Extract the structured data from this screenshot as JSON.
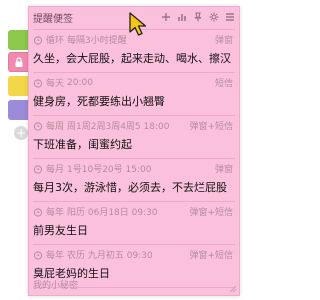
{
  "window": {
    "title": "提醒便签"
  },
  "toolbar": {
    "icons": [
      "add-icon",
      "bar-chart-icon",
      "pin-icon",
      "gear-icon",
      "menu-icon"
    ]
  },
  "reminders": [
    {
      "repeat": "循环",
      "when": "每隔3小时提醒",
      "type": "弹窗",
      "text": "久坐，会大屁股，起来走动、喝水、擦汉"
    },
    {
      "repeat": "每天",
      "when": "20:00",
      "type": "短信",
      "text": "健身房，死都要练出小翘臀"
    },
    {
      "repeat": "每周",
      "when": "周1周2周3周4周5  18:00",
      "type": "弹窗+短信",
      "text": "下班准备，闺蜜约起"
    },
    {
      "repeat": "每月",
      "when": "1号10号20号  15:00",
      "type": "弹窗",
      "text": "每月3次，游泳惜，必须去，不去烂屁股"
    },
    {
      "repeat": "每年",
      "when": "阳历  06月18日  09:30",
      "type": "弹窗+短信",
      "text": "前男友生日"
    },
    {
      "repeat": "每年",
      "when": "农历  九月初五  09:30",
      "type": "弹窗+短信",
      "text": "臭屁老妈的生日"
    }
  ],
  "footer": {
    "label": "我的小秘密"
  },
  "colors": {
    "window_bg": "#fbc1dc",
    "tab_green": "#8bc84b",
    "tab_pink": "#f28ab0",
    "tab_yellow": "#f3d64a",
    "tab_purple": "#9b8bd8",
    "cursor": "#f5c518"
  }
}
